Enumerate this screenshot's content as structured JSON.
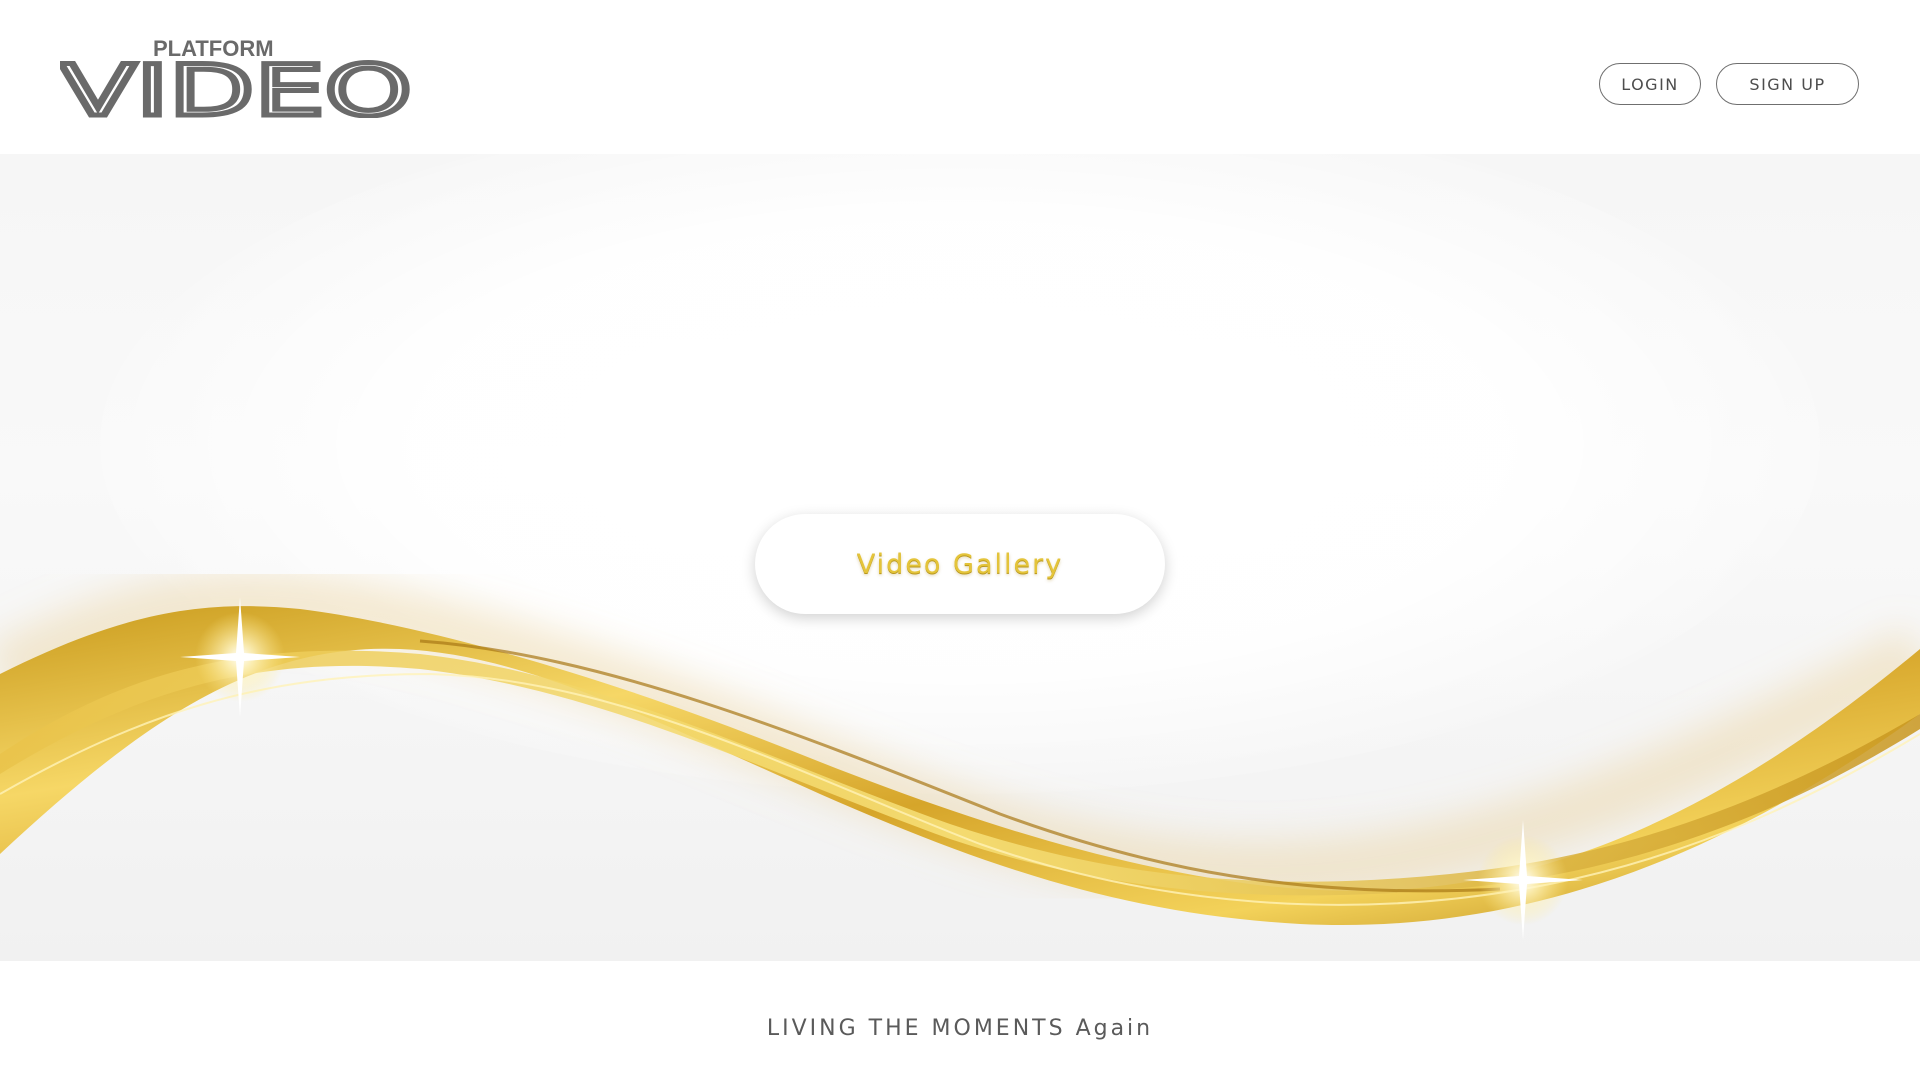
{
  "header": {
    "logo_small": "PLATFORM",
    "logo_big": "VIDEO",
    "login_label": "LOGIN",
    "signup_label": "SIGN UP"
  },
  "hero": {
    "cta_label": "Video Gallery"
  },
  "footer": {
    "tagline": "LIVING THE MOMENTS Again"
  },
  "colors": {
    "gold": "#e4c43a",
    "gold_dark": "#b8871a",
    "logo_gray": "#6a6a6a",
    "button_border": "#6f6f6f"
  },
  "icons": [
    "sparkle-icon",
    "sparkle-icon"
  ]
}
